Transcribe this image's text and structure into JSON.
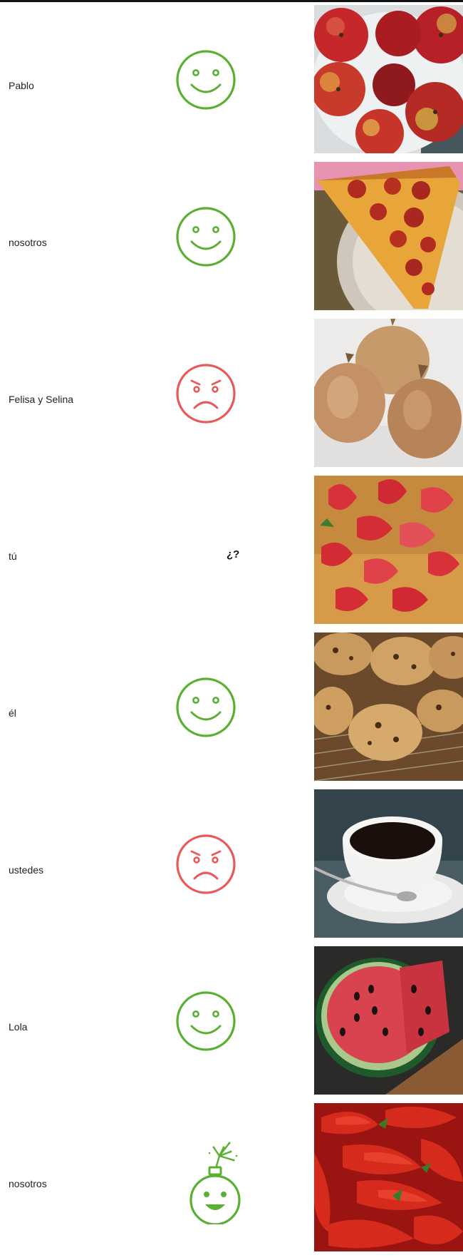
{
  "colors": {
    "happy": "#5ab032",
    "angry": "#e85a5a",
    "rule": "#111111"
  },
  "rows": [
    {
      "subject": "Pablo",
      "reaction": "happy-face-icon",
      "food": "apples-photo"
    },
    {
      "subject": "nosotros",
      "reaction": "happy-face-icon",
      "food": "pizza-photo"
    },
    {
      "subject": "Felisa y Selina",
      "reaction": "angry-face-icon",
      "food": "onions-photo"
    },
    {
      "subject": "tú",
      "reaction": "question-mark",
      "reaction_text": "¿?",
      "food": "strawberries-photo"
    },
    {
      "subject": "él",
      "reaction": "happy-face-icon",
      "food": "cookies-photo"
    },
    {
      "subject": "ustedes",
      "reaction": "angry-face-icon",
      "food": "coffee-photo"
    },
    {
      "subject": "Lola",
      "reaction": "happy-face-icon",
      "food": "watermelon-photo"
    },
    {
      "subject": "nosotros",
      "reaction": "bomb-face-icon",
      "food": "chili-peppers-photo"
    }
  ]
}
